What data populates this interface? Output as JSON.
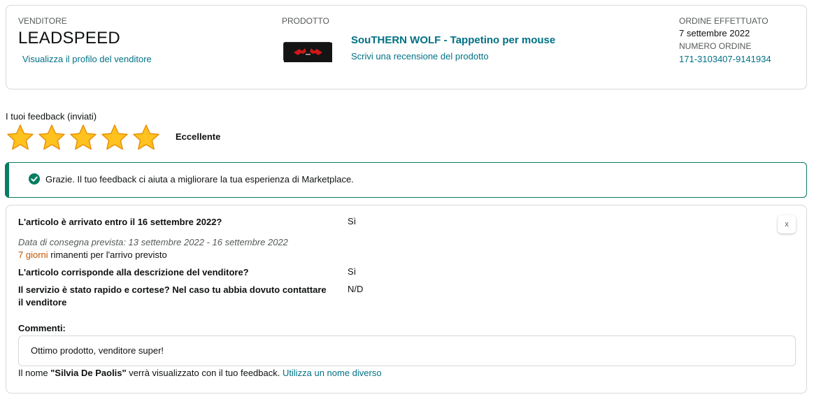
{
  "order": {
    "seller_label": "VENDITORE",
    "seller_name": "LEADSPEED",
    "seller_profile_link": "Visualizza il profilo del venditore",
    "product_label": "PRODOTTO",
    "product_title": "SouTHERN WOLF - Tappetino per mouse",
    "product_review_link": "Scrivi una recensione del prodotto",
    "order_date_label": "ORDINE EFFETTUATO",
    "order_date": "7 settembre 2022",
    "order_number_label": "NUMERO ORDINE",
    "order_number": "171-3103407-9141934"
  },
  "feedback": {
    "title": "I tuoi feedback (inviati)",
    "rating": 5,
    "rating_max": 5,
    "rating_label": "Eccellente",
    "star_color": "#ffa41c"
  },
  "alert": {
    "text": "Grazie. Il tuo feedback ci aiuta a migliorare la tua esperienza di Marketplace.",
    "color": "#067d62"
  },
  "questions": {
    "q1": "L'articolo è arrivato entro il 16 settembre 2022?",
    "a1": "Sì",
    "delivery_range": "Data di consegna prevista: 13 settembre 2022 - 16 settembre 2022",
    "remaining_days": "7 giorni",
    "remaining_text": " rimanenti per l'arrivo previsto",
    "q2": "L'articolo corrisponde alla descrizione del venditore?",
    "a2": "Sì",
    "q3": "Il servizio è stato rapido e cortese? Nel caso tu abbia dovuto contattare il venditore",
    "a3": "N/D",
    "close_label": "x",
    "comments_label": "Commenti:",
    "comment": "Ottimo prodotto, venditore super!",
    "name_prefix": "Il nome ",
    "name": "\"Silvia De Paolis\"",
    "name_suffix": " verrà visualizzato con il tuo feedback. ",
    "name_link": "Utilizza un nome diverso"
  }
}
